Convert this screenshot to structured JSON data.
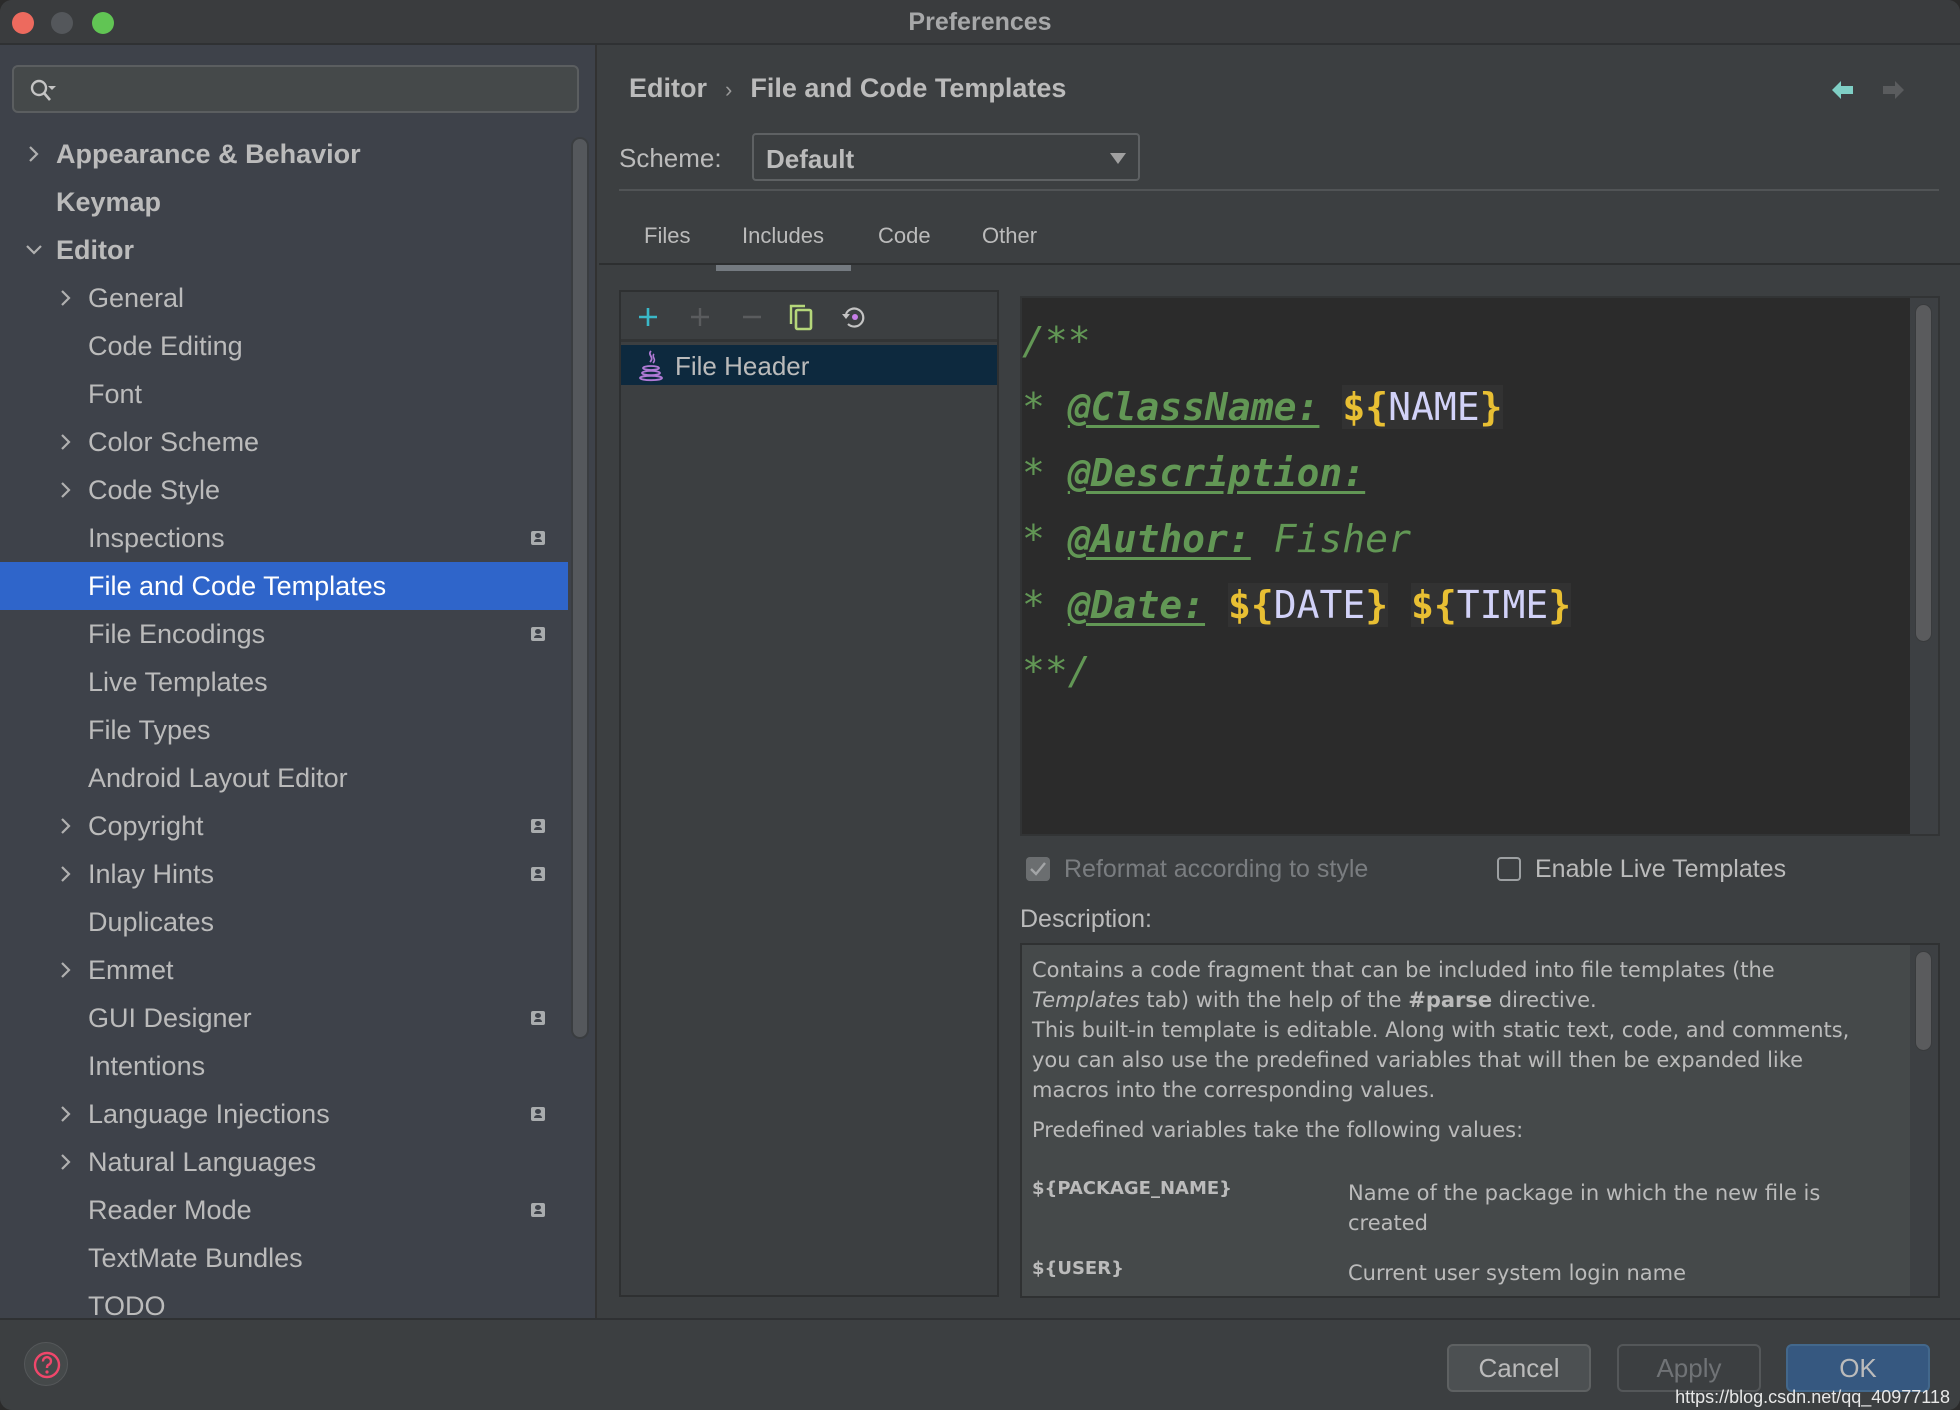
{
  "window": {
    "title": "Preferences"
  },
  "sidebar": {
    "search": {
      "placeholder": "",
      "value": ""
    },
    "items": [
      {
        "label": "Appearance & Behavior",
        "level": 0,
        "expander": "collapsed",
        "bold": true,
        "badge": false
      },
      {
        "label": "Keymap",
        "level": 0,
        "expander": "none",
        "bold": true,
        "badge": false
      },
      {
        "label": "Editor",
        "level": 0,
        "expander": "expanded",
        "bold": true,
        "badge": false
      },
      {
        "label": "General",
        "level": 1,
        "expander": "collapsed",
        "badge": false
      },
      {
        "label": "Code Editing",
        "level": 1,
        "expander": "none",
        "badge": false
      },
      {
        "label": "Font",
        "level": 1,
        "expander": "none",
        "badge": false
      },
      {
        "label": "Color Scheme",
        "level": 1,
        "expander": "collapsed",
        "badge": false
      },
      {
        "label": "Code Style",
        "level": 1,
        "expander": "collapsed",
        "badge": false
      },
      {
        "label": "Inspections",
        "level": 1,
        "expander": "none",
        "badge": true
      },
      {
        "label": "File and Code Templates",
        "level": 1,
        "expander": "none",
        "badge": false,
        "selected": true
      },
      {
        "label": "File Encodings",
        "level": 1,
        "expander": "none",
        "badge": true
      },
      {
        "label": "Live Templates",
        "level": 1,
        "expander": "none",
        "badge": false
      },
      {
        "label": "File Types",
        "level": 1,
        "expander": "none",
        "badge": false
      },
      {
        "label": "Android Layout Editor",
        "level": 1,
        "expander": "none",
        "badge": false
      },
      {
        "label": "Copyright",
        "level": 1,
        "expander": "collapsed",
        "badge": true
      },
      {
        "label": "Inlay Hints",
        "level": 1,
        "expander": "collapsed",
        "badge": true
      },
      {
        "label": "Duplicates",
        "level": 1,
        "expander": "none",
        "badge": false
      },
      {
        "label": "Emmet",
        "level": 1,
        "expander": "collapsed",
        "badge": false
      },
      {
        "label": "GUI Designer",
        "level": 1,
        "expander": "none",
        "badge": true
      },
      {
        "label": "Intentions",
        "level": 1,
        "expander": "none",
        "badge": false
      },
      {
        "label": "Language Injections",
        "level": 1,
        "expander": "collapsed",
        "badge": true
      },
      {
        "label": "Natural Languages",
        "level": 1,
        "expander": "collapsed",
        "badge": false
      },
      {
        "label": "Reader Mode",
        "level": 1,
        "expander": "none",
        "badge": true
      },
      {
        "label": "TextMate Bundles",
        "level": 1,
        "expander": "none",
        "badge": false
      },
      {
        "label": "TODO",
        "level": 1,
        "expander": "none",
        "badge": false
      }
    ]
  },
  "header": {
    "breadcrumb": [
      "Editor",
      "File and Code Templates"
    ],
    "breadcrumb_sep": "›",
    "nav_back_color": "#7fcfc5",
    "nav_forward_color": "#5a5c5e"
  },
  "scheme": {
    "label": "Scheme:",
    "value": "Default"
  },
  "tabs": [
    {
      "label": "Files",
      "active": false
    },
    {
      "label": "Includes",
      "active": true
    },
    {
      "label": "Code",
      "active": false
    },
    {
      "label": "Other",
      "active": false
    }
  ],
  "toolbar": {
    "buttons": [
      {
        "name": "add-icon",
        "color": "#3ab8c8",
        "enabled": true
      },
      {
        "name": "add-child-icon",
        "color": "#5a5c5e",
        "enabled": false
      },
      {
        "name": "remove-icon",
        "color": "#5a5c5e",
        "enabled": false
      },
      {
        "name": "copy-icon",
        "color": "#b5d77a",
        "enabled": true
      },
      {
        "name": "reset-icon",
        "color": "#c4c4c4",
        "enabled": true
      }
    ]
  },
  "templates": [
    {
      "label": "File Header",
      "icon": "java-icon",
      "selected": true
    }
  ],
  "editor": {
    "lines": [
      [
        {
          "t": "/**",
          "k": "com"
        }
      ],
      [
        {
          "t": "* ",
          "k": "com"
        },
        {
          "t": "@ClassName:",
          "k": "tag"
        },
        {
          "t": " ",
          "k": "com"
        },
        {
          "t": "NAME",
          "k": "var"
        }
      ],
      [
        {
          "t": "* ",
          "k": "com"
        },
        {
          "t": "@Description:",
          "k": "tag"
        }
      ],
      [
        {
          "t": "* ",
          "k": "com"
        },
        {
          "t": "@Author:",
          "k": "tag"
        },
        {
          "t": " Fisher",
          "k": "com"
        }
      ],
      [
        {
          "t": "* ",
          "k": "com"
        },
        {
          "t": "@Date:",
          "k": "tag"
        },
        {
          "t": " ",
          "k": "com"
        },
        {
          "t": "DATE",
          "k": "var"
        },
        {
          "t": " ",
          "k": "com"
        },
        {
          "t": "TIME",
          "k": "var"
        }
      ],
      [
        {
          "t": "**/",
          "k": "com"
        }
      ]
    ],
    "colors": {
      "comment": "#629755",
      "var_delim": "#e8bf33",
      "var_name": "#d2d2f8",
      "background": "#2b2b2b"
    }
  },
  "options": {
    "reformat": {
      "label": "Reformat according to style",
      "checked": true,
      "enabled": false
    },
    "live_templates": {
      "label": "Enable Live Templates",
      "checked": false,
      "enabled": true
    }
  },
  "description": {
    "label": "Description:",
    "intro_a": "Contains a code fragment that can be included into file templates (the ",
    "intro_italic": "Templates",
    "intro_b": " tab) with the help of the ",
    "intro_bold": "#parse",
    "intro_c": " directive.",
    "editable": "This built-in template is editable. Along with static text, code, and comments, you can also use the predefined variables that will then be expanded like macros into the corresponding values.",
    "vars_heading": "Predefined variables take the following values:",
    "variables": [
      {
        "name": "${PACKAGE_NAME}",
        "desc": "Name of the package in which the new file is created"
      },
      {
        "name": "${USER}",
        "desc": "Current user system login name"
      }
    ]
  },
  "footer": {
    "cancel": "Cancel",
    "apply": "Apply",
    "ok": "OK",
    "watermark": "https://blog.csdn.net/qq_40977118"
  }
}
